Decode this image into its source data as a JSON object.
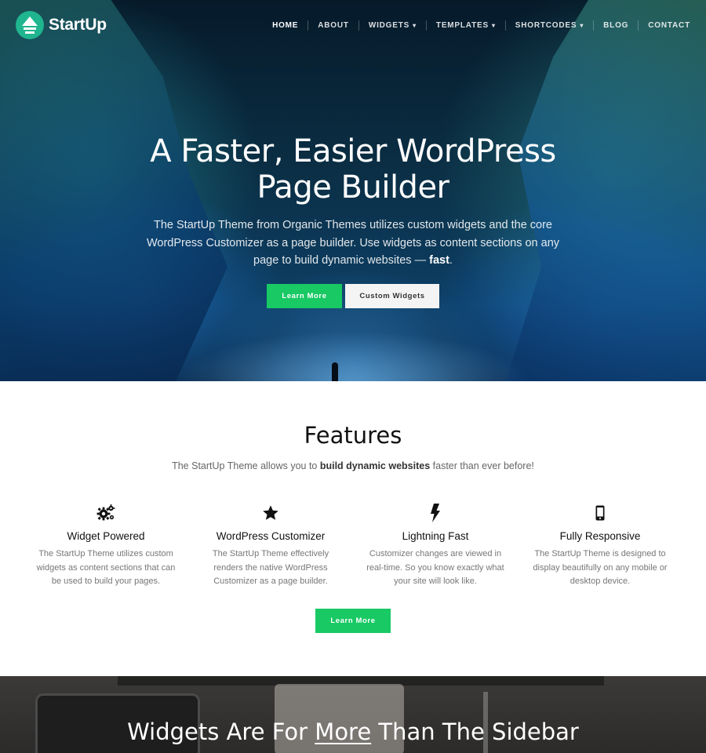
{
  "brand": {
    "name": "StartUp",
    "color": "#1fb58f"
  },
  "nav": {
    "items": [
      {
        "label": "HOME",
        "active": true
      },
      {
        "label": "ABOUT"
      },
      {
        "label": "WIDGETS",
        "dropdown": true
      },
      {
        "label": "TEMPLATES",
        "dropdown": true
      },
      {
        "label": "SHORTCODES",
        "dropdown": true
      },
      {
        "label": "BLOG"
      },
      {
        "label": "CONTACT"
      }
    ]
  },
  "hero": {
    "title_line1": "A Faster, Easier WordPress",
    "title_line2": "Page Builder",
    "subtitle_before": "The StartUp Theme from Organic Themes utilizes custom widgets and the core WordPress Customizer as a page builder. Use widgets as content sections on any page to build dynamic websites — ",
    "subtitle_bold": "fast",
    "subtitle_after": ".",
    "primary_button": "Learn More",
    "secondary_button": "Custom Widgets"
  },
  "features": {
    "title": "Features",
    "subtitle_before": "The StartUp Theme allows you to ",
    "subtitle_bold": "build dynamic websites",
    "subtitle_after": " faster than ever before!",
    "items": [
      {
        "icon": "gears-icon",
        "title": "Widget Powered",
        "text": "The StartUp Theme utilizes custom widgets as content sections that can be used to build your pages."
      },
      {
        "icon": "star-icon",
        "title": "WordPress Customizer",
        "text": "The StartUp Theme effectively renders the native WordPress Customizer as a page builder."
      },
      {
        "icon": "lightning-icon",
        "title": "Lightning Fast",
        "text": "Customizer changes are viewed in real-time. So you know exactly what your site will look like."
      },
      {
        "icon": "mobile-icon",
        "title": "Fully Responsive",
        "text": "The StartUp Theme is designed to display beautifully on any mobile or desktop device."
      }
    ],
    "button": "Learn More"
  },
  "band": {
    "title_before": "Widgets Are For ",
    "title_underlined": "More",
    "title_after": " Than The Sidebar"
  },
  "colors": {
    "accent": "#18c964",
    "button_light": "#f4f4f4"
  }
}
